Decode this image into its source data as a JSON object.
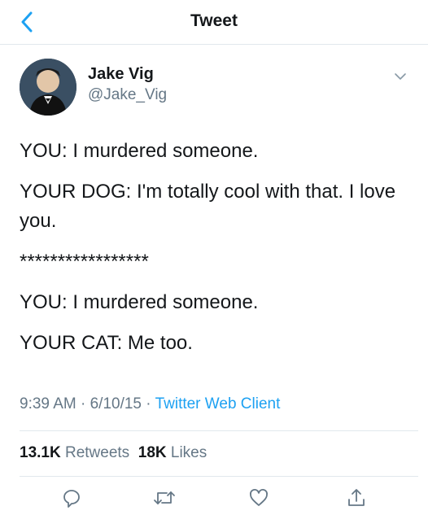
{
  "header": {
    "title": "Tweet"
  },
  "author": {
    "name": "Jake Vig",
    "handle": "@Jake_Vig"
  },
  "tweet": {
    "lines": [
      "YOU: I murdered someone.",
      "YOUR DOG: I'm totally cool with that. I love you.",
      "*****************",
      "YOU: I murdered someone.",
      "YOUR CAT: Me too."
    ]
  },
  "meta": {
    "time": "9:39 AM",
    "sep1": " · ",
    "date": "6/10/15",
    "sep2": " · ",
    "client": "Twitter Web Client"
  },
  "stats": {
    "retweets_count": "13.1K",
    "retweets_label": "Retweets",
    "likes_count": "18K",
    "likes_label": "Likes"
  },
  "colors": {
    "accent": "#1da1f2",
    "secondary": "#657786",
    "divider": "#e1e8ed"
  },
  "icons": [
    "back-arrow-icon",
    "chevron-down-icon",
    "reply-icon",
    "retweet-icon",
    "like-icon",
    "share-icon"
  ]
}
